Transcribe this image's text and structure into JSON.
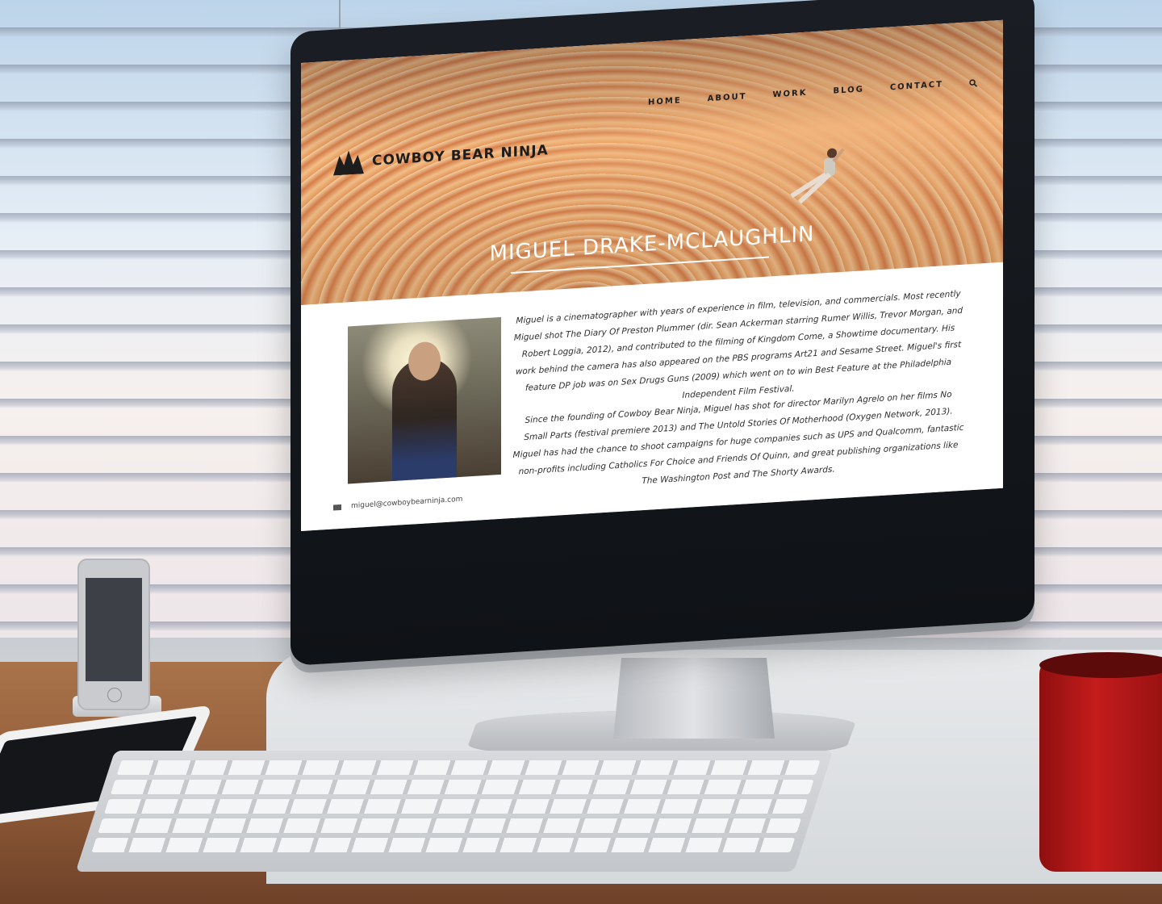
{
  "site": {
    "logo_text": "COWBOY BEAR NINJA",
    "nav": [
      "HOME",
      "ABOUT",
      "WORK",
      "BLOG",
      "CONTACT"
    ],
    "page_title": "MIGUEL DRAKE-MCLAUGHLIN",
    "bio_paragraph_1": "Miguel is a cinematographer with years of experience in film, television, and commercials. Most recently Miguel shot The Diary Of Preston Plummer (dir. Sean Ackerman starring Rumer Willis, Trevor Morgan, and Robert Loggia, 2012), and contributed to the filming of Kingdom Come, a Showtime documentary. His work behind the camera has also appeared on the PBS programs Art21 and Sesame Street. Miguel's first feature DP job was on Sex Drugs Guns (2009) which went on to win Best Feature at the Philadelphia Independent Film Festival.",
    "bio_paragraph_2": "Since the founding of Cowboy Bear Ninja, Miguel has shot for director Marilyn Agrelo on her films No Small Parts (festival premiere 2013) and The Untold Stories Of Motherhood (Oxygen Network, 2013). Miguel has had the chance to shoot campaigns for huge companies such as UPS and Qualcomm, fantastic non-profits including Catholics For Choice and Friends Of Quinn, and great publishing organizations like The Washington Post and The Shorty Awards.",
    "email": "miguel@cowboybearninja.com"
  },
  "icons": {
    "search": "search-icon",
    "mail": "mail-icon",
    "apple": "apple-logo-icon"
  },
  "colors": {
    "screen_bezel": "#111419",
    "hero_orange": "#e89a5a",
    "text": "#2e2e2e",
    "mug_red": "#c41c1c"
  }
}
